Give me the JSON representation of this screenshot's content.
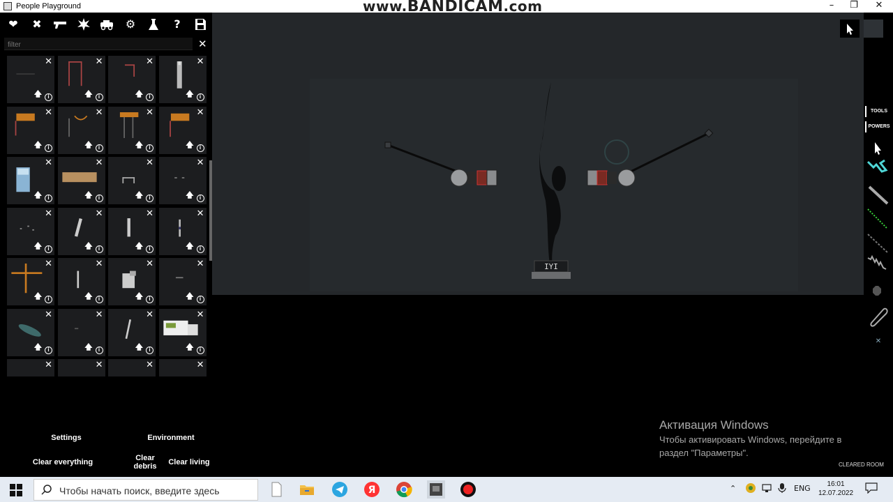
{
  "window": {
    "title": "People Playground",
    "watermark_prefix": "www.",
    "watermark_brand": "BANDICAM",
    "watermark_suffix": ".com",
    "controls": [
      "minimize",
      "maximize",
      "close"
    ]
  },
  "toolbar": {
    "icons": [
      "heart-icon",
      "swords-icon",
      "gun-icon",
      "explosion-icon",
      "vehicle-icon",
      "gear-icon",
      "flask-icon",
      "question-icon",
      "save-icon"
    ]
  },
  "filter": {
    "placeholder": "filter",
    "value": ""
  },
  "spawn_grid": {
    "columns": 4,
    "visible_rows": 7,
    "close_glyph": "✕",
    "upvote_glyph": "🡅",
    "info_glyph": "i"
  },
  "viewport": {
    "background": "#24272a"
  },
  "right_tools": {
    "tools_label": "TOOLS",
    "powers_label": "POWERS"
  },
  "bottom_menu": {
    "settings": "Settings",
    "environment": "Environment",
    "clear_everything": "Clear everything",
    "clear_debris_1": "Clear",
    "clear_debris_2": "debris",
    "clear_living": "Clear living"
  },
  "activation": {
    "heading": "Активация Windows",
    "line1": "Чтобы активировать Windows, перейдите в",
    "line2": "раздел \"Параметры\"."
  },
  "status": {
    "cleared_room": "CLEARED ROOM"
  },
  "taskbar": {
    "search_placeholder": "Чтобы начать поиск, введите здесь",
    "apps": [
      "file-icon",
      "folder-icon",
      "telegram-icon",
      "yandex-icon",
      "chrome-icon",
      "game-icon",
      "bandicam-record-icon"
    ],
    "language": "ENG",
    "time": "16:01",
    "date": "12.07.2022"
  }
}
